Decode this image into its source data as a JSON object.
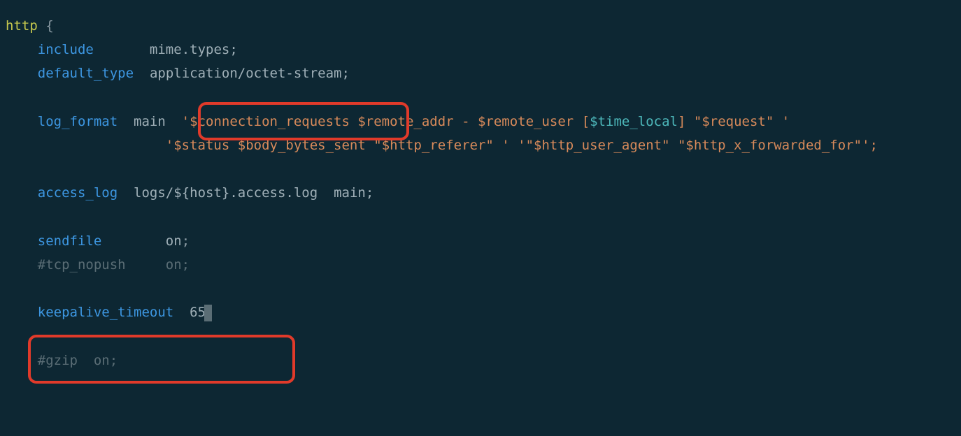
{
  "code": {
    "line1_http": "http",
    "line1_brace": " {",
    "indent": "    ",
    "line2_include": "include",
    "line2_spaces": "       ",
    "line2_value": "mime",
    "line2_dot_types": ".types;",
    "line3_default_type": "default_type",
    "line3_spaces": "  ",
    "line3_value": "application/octet-stream;",
    "line5_log_format": "log_format",
    "line5_main": "  main  ",
    "line5_quote": "'",
    "line5_conn_req": "$connection_requests",
    "line5_space": " ",
    "line5_remote_addr": "$remote_addr",
    "line5_dash": " - ",
    "line5_remote_user": "$remote_user",
    "line5_bracket_open": " [",
    "line5_time_local": "$time_local",
    "line5_bracket_close": "] \"",
    "line5_request": "$request",
    "line5_end_quote": "\" '",
    "indent_long": "                    ",
    "line6_quote": "'",
    "line6_status": "$status",
    "line6_sp": " ",
    "line6_body_bytes": "$body_bytes_sent",
    "line6_ref_open": " \"",
    "line6_http_referer": "$http_referer",
    "line6_ref_close": "\" ' '\"",
    "line6_http_ua": "$http_user_agent",
    "line6_ua_close": "\" \"",
    "line6_http_xff": "$http_x_forwarded_for",
    "line6_end": "\"';",
    "line8_access_log": "access_log",
    "line8_sp": "  ",
    "line8_logs": "logs/",
    "line8_host_open": "${",
    "line8_host": "host",
    "line8_host_close": "}",
    "line8_suffix": ".access.log",
    "line8_main": "  main;",
    "line10_sendfile": "sendfile",
    "line10_sp": "        ",
    "line10_on": "on",
    "line10_semi": ";",
    "line11_comment": "#tcp_nopush     on;",
    "line13_keepalive": "keepalive_timeout",
    "line13_sp": "  ",
    "line13_val": "65",
    "line13_semi": ";",
    "line15_comment": "#gzip  on;"
  }
}
